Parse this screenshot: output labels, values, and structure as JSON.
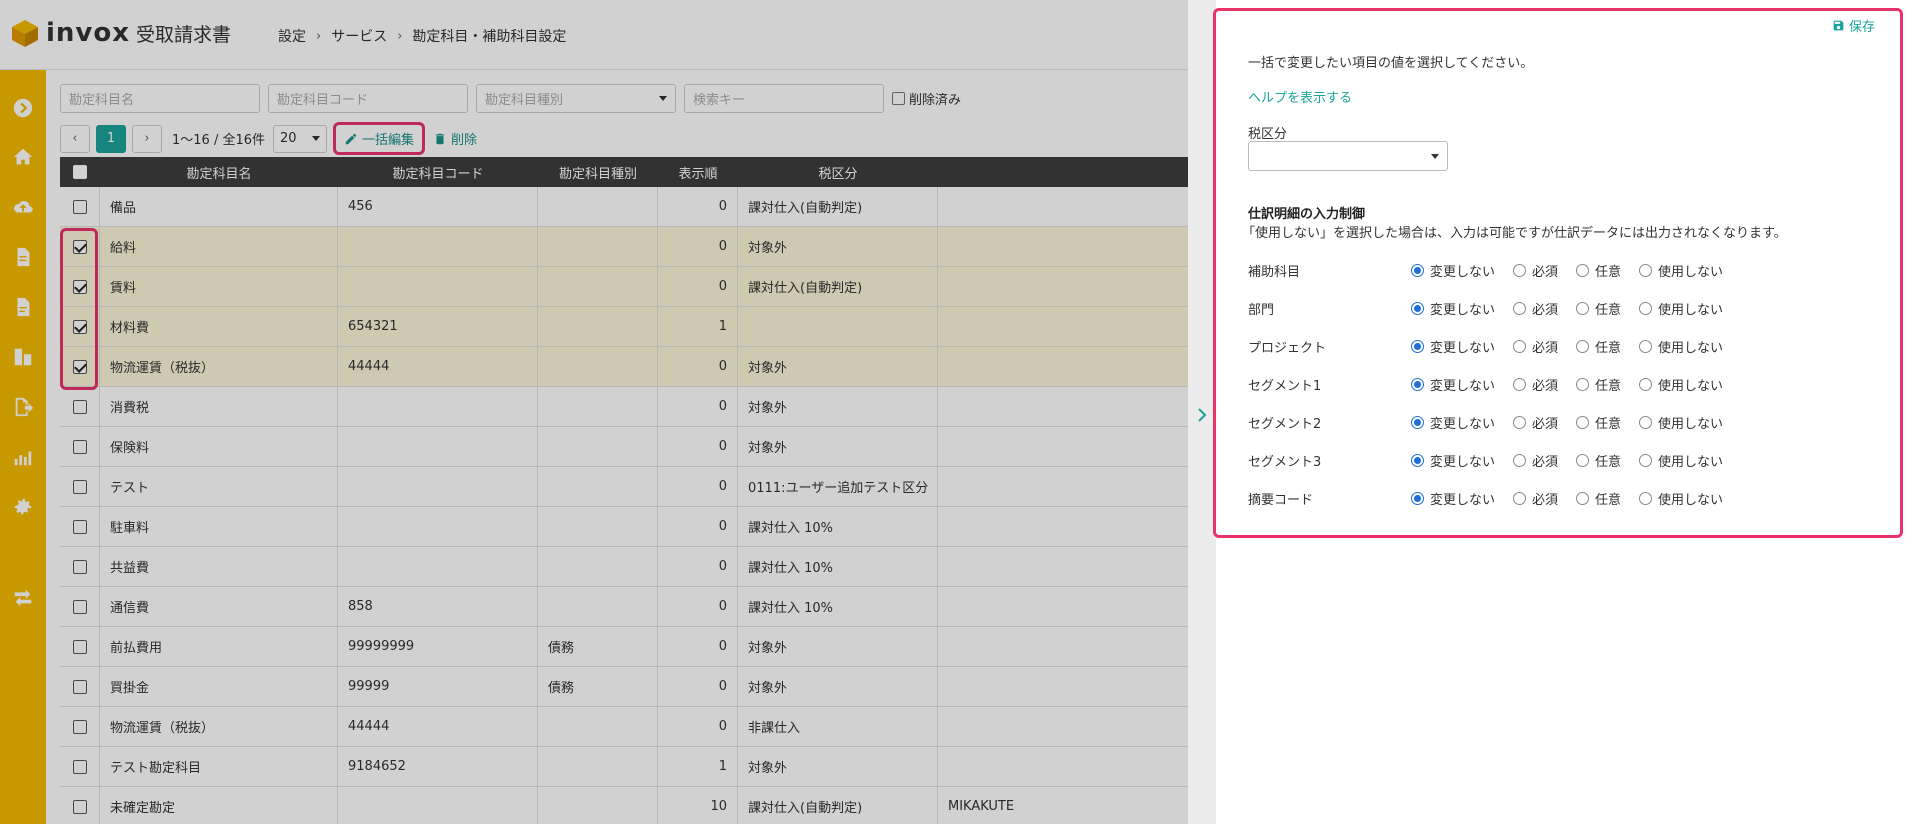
{
  "app": {
    "brand": "invox",
    "product": "受取請求書"
  },
  "breadcrumb": [
    "設定",
    "サービス",
    "勘定科目・補助科目設定"
  ],
  "sidebar": {
    "icons": [
      "arrow-right-circle-icon",
      "home-icon",
      "cloud-upload-icon",
      "document-icon",
      "document-list-icon",
      "buildings-icon",
      "export-icon",
      "chart-icon",
      "gear-icon",
      "transfer-icon"
    ]
  },
  "filters": {
    "name_placeholder": "勘定科目名",
    "code_placeholder": "勘定科目コード",
    "type_placeholder": "勘定科目種別",
    "search_placeholder": "検索キー",
    "deleted_label": "削除済み"
  },
  "pager": {
    "current_page": "1",
    "range": "1〜16 / 全16件",
    "page_size": "20",
    "bulk_edit": "一括編集",
    "delete": "削除"
  },
  "table": {
    "headers": {
      "name": "勘定科目名",
      "code": "勘定科目コード",
      "type": "勘定科目種別",
      "order": "表示順",
      "tax": "税区分"
    },
    "rows": [
      {
        "selected": false,
        "name": "備品",
        "code": "456",
        "type": "",
        "order": "0",
        "tax": "課対仕入(自動判定)",
        "extra": ""
      },
      {
        "selected": true,
        "name": "給料",
        "code": "",
        "type": "",
        "order": "0",
        "tax": "対象外",
        "extra": ""
      },
      {
        "selected": true,
        "name": "賃料",
        "code": "",
        "type": "",
        "order": "0",
        "tax": "課対仕入(自動判定)",
        "extra": ""
      },
      {
        "selected": true,
        "name": "材料費",
        "code": "654321",
        "type": "",
        "order": "1",
        "tax": "",
        "extra": ""
      },
      {
        "selected": true,
        "name": "物流運賃（税抜）",
        "code": "44444",
        "type": "",
        "order": "0",
        "tax": "対象外",
        "extra": ""
      },
      {
        "selected": false,
        "name": "消費税",
        "code": "",
        "type": "",
        "order": "0",
        "tax": "対象外",
        "extra": ""
      },
      {
        "selected": false,
        "name": "保険料",
        "code": "",
        "type": "",
        "order": "0",
        "tax": "対象外",
        "extra": ""
      },
      {
        "selected": false,
        "name": "テスト",
        "code": "",
        "type": "",
        "order": "0",
        "tax": "0111:ユーザー追加テスト区分",
        "extra": ""
      },
      {
        "selected": false,
        "name": "駐車料",
        "code": "",
        "type": "",
        "order": "0",
        "tax": "課対仕入 10%",
        "extra": ""
      },
      {
        "selected": false,
        "name": "共益費",
        "code": "",
        "type": "",
        "order": "0",
        "tax": "課対仕入 10%",
        "extra": ""
      },
      {
        "selected": false,
        "name": "通信費",
        "code": "858",
        "type": "",
        "order": "0",
        "tax": "課対仕入 10%",
        "extra": ""
      },
      {
        "selected": false,
        "name": "前払費用",
        "code": "99999999",
        "type": "債務",
        "order": "0",
        "tax": "対象外",
        "extra": ""
      },
      {
        "selected": false,
        "name": "買掛金",
        "code": "99999",
        "type": "債務",
        "order": "0",
        "tax": "対象外",
        "extra": ""
      },
      {
        "selected": false,
        "name": "物流運賃（税抜）",
        "code": "44444",
        "type": "",
        "order": "0",
        "tax": "非課仕入",
        "extra": ""
      },
      {
        "selected": false,
        "name": "テスト勘定科目",
        "code": "9184652",
        "type": "",
        "order": "1",
        "tax": "対象外",
        "extra": ""
      },
      {
        "selected": false,
        "name": "未確定勘定",
        "code": "",
        "type": "",
        "order": "10",
        "tax": "課対仕入(自動判定)",
        "extra": "MIKAKUTE"
      }
    ]
  },
  "panel": {
    "save": "保存",
    "instruction": "一括で変更したい項目の値を選択してください。",
    "help_link": "ヘルプを表示する",
    "tax_label": "税区分",
    "tax_value": "",
    "control_title": "仕訳明細の入力制御",
    "control_desc": "「使用しない」を選択した場合は、入力は可能ですが仕訳データには出力されなくなります。",
    "options": [
      "変更しない",
      "必須",
      "任意",
      "使用しない"
    ],
    "controls": [
      {
        "label": "補助科目",
        "selected": "変更しない"
      },
      {
        "label": "部門",
        "selected": "変更しない"
      },
      {
        "label": "プロジェクト",
        "selected": "変更しない"
      },
      {
        "label": "セグメント1",
        "selected": "変更しない"
      },
      {
        "label": "セグメント2",
        "selected": "変更しない"
      },
      {
        "label": "セグメント3",
        "selected": "変更しない"
      },
      {
        "label": "摘要コード",
        "selected": "変更しない"
      }
    ]
  },
  "colors": {
    "accent": "#1aa39a",
    "sidebar": "#f5ba00",
    "highlight": "#e8336b",
    "radio": "#1e6fd9"
  }
}
